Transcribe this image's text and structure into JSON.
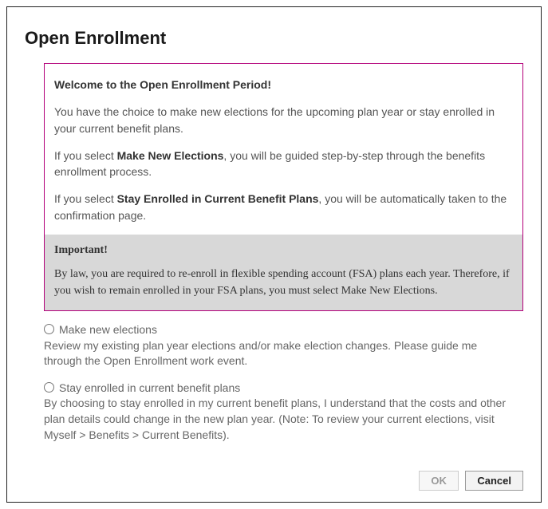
{
  "title": "Open Enrollment",
  "intro": {
    "welcome": "Welcome to the Open Enrollment Period!",
    "p1": "You have the choice to make new elections for the upcoming plan year or stay enrolled in your current benefit plans.",
    "p2_pre": "If you select ",
    "p2_b": "Make New Elections",
    "p2_post": ", you will be guided step-by-step through the benefits enrollment process.",
    "p3_pre": "If you select ",
    "p3_b": "Stay Enrolled in Current Benefit Plans",
    "p3_post": ", you will be automatically taken to the confirmation page."
  },
  "important": {
    "title": "Important!",
    "body": "By law, you are required to re-enroll in flexible spending account (FSA) plans each year. Therefore, if you wish to remain enrolled in your FSA plans, you must select Make New Elections."
  },
  "options": {
    "opt1_label": "Make new elections",
    "opt1_desc": "Review my existing plan year elections and/or make election changes. Please guide me through the Open Enrollment work event.",
    "opt2_label": "Stay enrolled in current benefit plans",
    "opt2_desc": "By choosing to stay enrolled in my current benefit plans, I understand that the costs and other plan details could change in the new plan year. (Note: To review your current elections, visit Myself > Benefits > Current Benefits)."
  },
  "buttons": {
    "ok": "OK",
    "cancel": "Cancel"
  }
}
